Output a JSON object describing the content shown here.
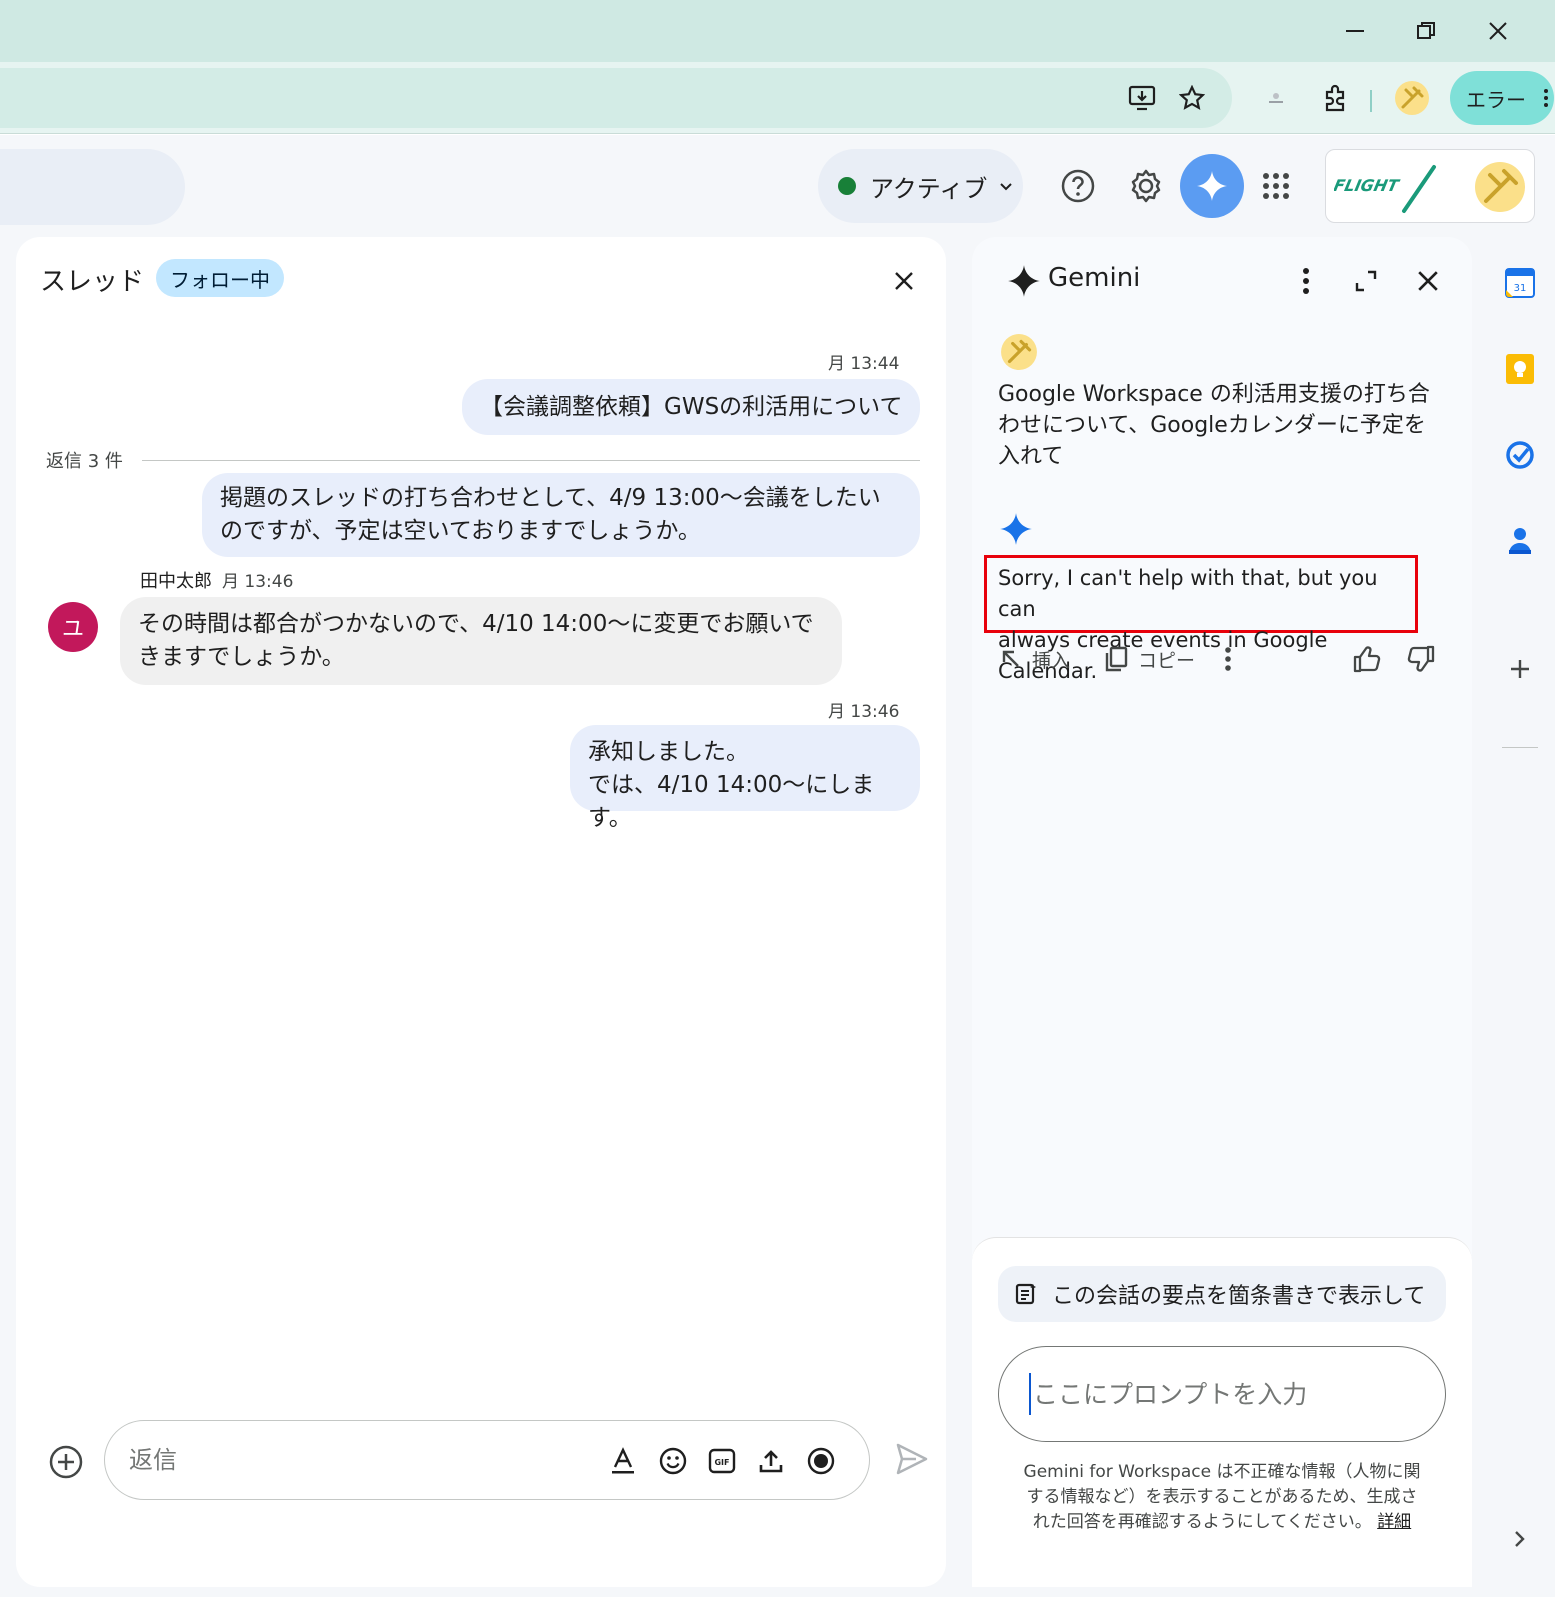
{
  "browser": {
    "profile_label": "エラー",
    "colors": {
      "titlebar": "#cfe9e3",
      "toolbar": "#e6f4f1",
      "profile_pill": "#7fe0d8"
    }
  },
  "header": {
    "status_label": "アクティブ",
    "status_color": "#188038",
    "icons": [
      "help-icon",
      "settings-icon",
      "gemini-icon",
      "apps-grid-icon"
    ],
    "brand_logo_text": "FLIGHT"
  },
  "thread": {
    "title": "スレッド",
    "follow_badge": "フォロー中",
    "reply_count_label": "返信 3 件",
    "messages": [
      {
        "time": "月 13:44",
        "text": "【会議調整依頼】GWSの利活用について"
      },
      {
        "text_line1": "掲題のスレッドの打ち合わせとして、4/9 13:00～会議をしたい",
        "text_line2": "のですが、予定は空いておりますでしょうか。"
      },
      {
        "sender": "田中太郎",
        "time": "月 13:46",
        "avatar_letter": "ユ",
        "text_line1": "その時間は都合がつかないので、4/10 14:00～に変更でお願いで",
        "text_line2": "きますでしょうか。"
      },
      {
        "time": "月 13:46",
        "text_line1": "承知しました。",
        "text_line2": "では、4/10 14:00～にします。"
      }
    ],
    "composer_placeholder": "返信"
  },
  "gemini": {
    "title": "Gemini",
    "user_prompt": "Google Workspace の利活用支援の打ち合わせについて、Googleカレンダーに予定を入れて",
    "reply_line1": "Sorry, I can't help with that, but you can",
    "reply_line2": "always create events in Google Calendar.",
    "action_insert": "挿入",
    "action_copy": "コピー",
    "suggestion_chip": "この会話の要点を箇条書きで表示して",
    "prompt_placeholder": "ここにプロンプトを入力",
    "disclaimer_line1": "Gemini for Workspace は不正確な情報（人物に関",
    "disclaimer_line2": "する情報など）を表示することがあるため、生成さ",
    "disclaimer_line3": "れた回答を再確認するようにしてください。",
    "disclaimer_link": "詳細",
    "highlight_color": "#e8000b"
  },
  "side_rail": {
    "icons": [
      "calendar-icon",
      "keep-icon",
      "tasks-icon",
      "contacts-icon",
      "add-icon",
      "expand-rail-icon"
    ],
    "calendar_day": "31"
  }
}
